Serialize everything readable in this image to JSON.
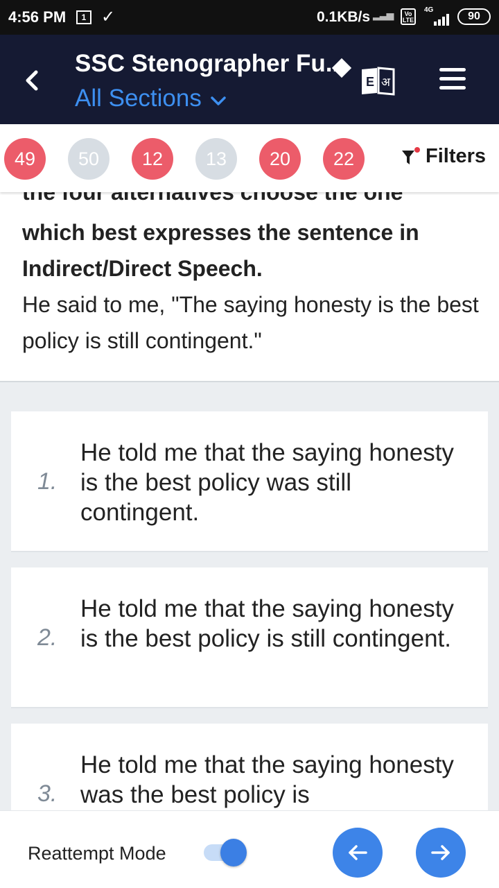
{
  "status_bar": {
    "time": "4:56 PM",
    "notification_box": "1",
    "data_speed": "0.1KB/s",
    "volte": "Vo LTE",
    "network": "4G",
    "battery": "90"
  },
  "header": {
    "title": "SSC Stenographer Fu...",
    "section": "All Sections",
    "lang_left": "E",
    "lang_right": "अ"
  },
  "filters": {
    "pills": [
      {
        "value": "49",
        "color": "#ec5c6a"
      },
      {
        "value": "50",
        "color": "#d7dde3"
      },
      {
        "value": "12",
        "color": "#ec5c6a"
      },
      {
        "value": "13",
        "color": "#d7dde3"
      },
      {
        "value": "20",
        "color": "#ec5c6a"
      },
      {
        "value": "22",
        "color": "#ec5c6a"
      }
    ],
    "label": "Filters"
  },
  "question": {
    "cutoff_line": "the four alternatives choose the one",
    "instruction": "which best expresses the sentence in Indirect/Direct Speech.",
    "text": "He said to me, \"The saying honesty is the best policy is still contingent.\""
  },
  "options": [
    {
      "number": "1.",
      "text": "He told me that the saying honesty is the best policy was still contingent."
    },
    {
      "number": "2.",
      "text": "He told me that the saying honesty is the best policy is still contingent."
    },
    {
      "number": "3.",
      "text": "He told me that the saying honesty was the best policy is"
    }
  ],
  "bottom": {
    "reattempt_label": "Reattempt Mode",
    "reattempt_on": true
  },
  "colors": {
    "header_bg": "#151a33",
    "accent_blue": "#3d84e8",
    "pill_red": "#ec5c6a",
    "pill_grey": "#d7dde3"
  }
}
